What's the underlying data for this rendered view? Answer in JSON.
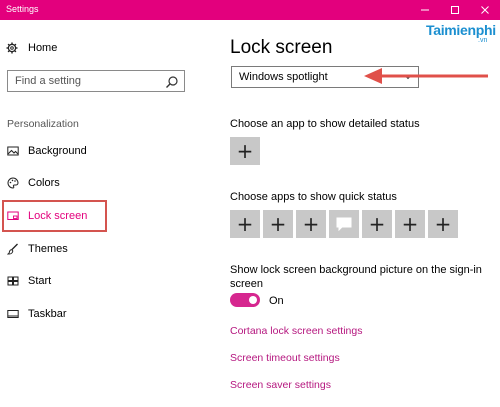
{
  "window": {
    "title": "Settings",
    "controls": {
      "minimize": "—",
      "maximize": "☐",
      "close": "✕"
    },
    "accent": "#e3007d"
  },
  "watermark": {
    "brand": "Taimienphi",
    "domain": ".vn"
  },
  "sidebar": {
    "home": {
      "label": "Home",
      "icon": "gear-icon"
    },
    "search": {
      "placeholder": "Find a setting",
      "icon": "search-icon"
    },
    "section": "Personalization",
    "items": [
      {
        "label": "Background",
        "icon": "image-icon",
        "selected": false
      },
      {
        "label": "Colors",
        "icon": "palette-icon",
        "selected": false
      },
      {
        "label": "Lock screen",
        "icon": "lock-screen-icon",
        "selected": true
      },
      {
        "label": "Themes",
        "icon": "brush-icon",
        "selected": false
      },
      {
        "label": "Start",
        "icon": "start-icon",
        "selected": false
      },
      {
        "label": "Taskbar",
        "icon": "taskbar-icon",
        "selected": false
      }
    ]
  },
  "main": {
    "title": "Lock screen",
    "background_dropdown": {
      "value": "Windows spotlight",
      "icon": "chevron-down-icon"
    },
    "detailed_status": {
      "label": "Choose an app to show detailed status",
      "tiles": [
        "plus"
      ]
    },
    "quick_status": {
      "label": "Choose apps to show quick status",
      "tiles": [
        "plus",
        "plus",
        "plus",
        "message",
        "plus",
        "plus",
        "plus"
      ]
    },
    "signin_background": {
      "label_line1": "Show lock screen background picture on the sign-in",
      "label_line2": "screen",
      "state": "On",
      "on": true
    },
    "links": [
      "Cortana lock screen settings",
      "Screen timeout settings",
      "Screen saver settings"
    ]
  },
  "annotation": {
    "arrow_color": "#e0504a",
    "box_color": "#d4544f"
  }
}
